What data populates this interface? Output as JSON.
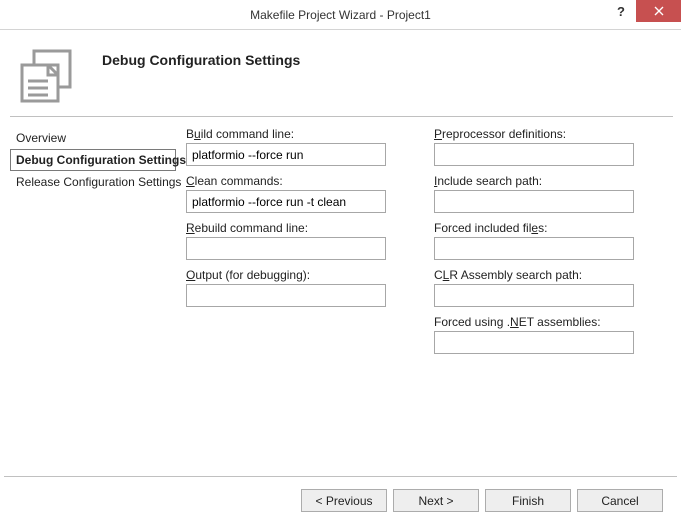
{
  "titlebar": {
    "title": "Makefile Project Wizard - Project1",
    "help": "?",
    "close": "✕"
  },
  "header": {
    "title": "Debug Configuration Settings"
  },
  "sidebar": {
    "items": [
      {
        "label": "Overview",
        "selected": false
      },
      {
        "label": "Debug Configuration Settings",
        "selected": true
      },
      {
        "label": "Release Configuration Settings",
        "selected": false
      }
    ]
  },
  "form": {
    "left": [
      {
        "label_pre": "B",
        "label_u": "u",
        "label_post": "ild command line:",
        "value": "platformio --force run"
      },
      {
        "label_pre": "",
        "label_u": "C",
        "label_post": "lean commands:",
        "value": "platformio --force run -t clean"
      },
      {
        "label_pre": "",
        "label_u": "R",
        "label_post": "ebuild command line:",
        "value": ""
      },
      {
        "label_pre": "",
        "label_u": "O",
        "label_post": "utput (for debugging):",
        "value": ""
      }
    ],
    "right": [
      {
        "label_pre": "",
        "label_u": "P",
        "label_post": "reprocessor definitions:",
        "value": ""
      },
      {
        "label_pre": "",
        "label_u": "I",
        "label_post": "nclude search path:",
        "value": ""
      },
      {
        "label_pre": "Forced included fil",
        "label_u": "e",
        "label_post": "s:",
        "value": ""
      },
      {
        "label_pre": "C",
        "label_u": "L",
        "label_post": "R Assembly search path:",
        "value": ""
      },
      {
        "label_pre": "Forced using .",
        "label_u": "N",
        "label_post": "ET assemblies:",
        "value": ""
      }
    ]
  },
  "footer": {
    "previous": "< Previous",
    "next": "Next >",
    "finish": "Finish",
    "cancel": "Cancel"
  }
}
